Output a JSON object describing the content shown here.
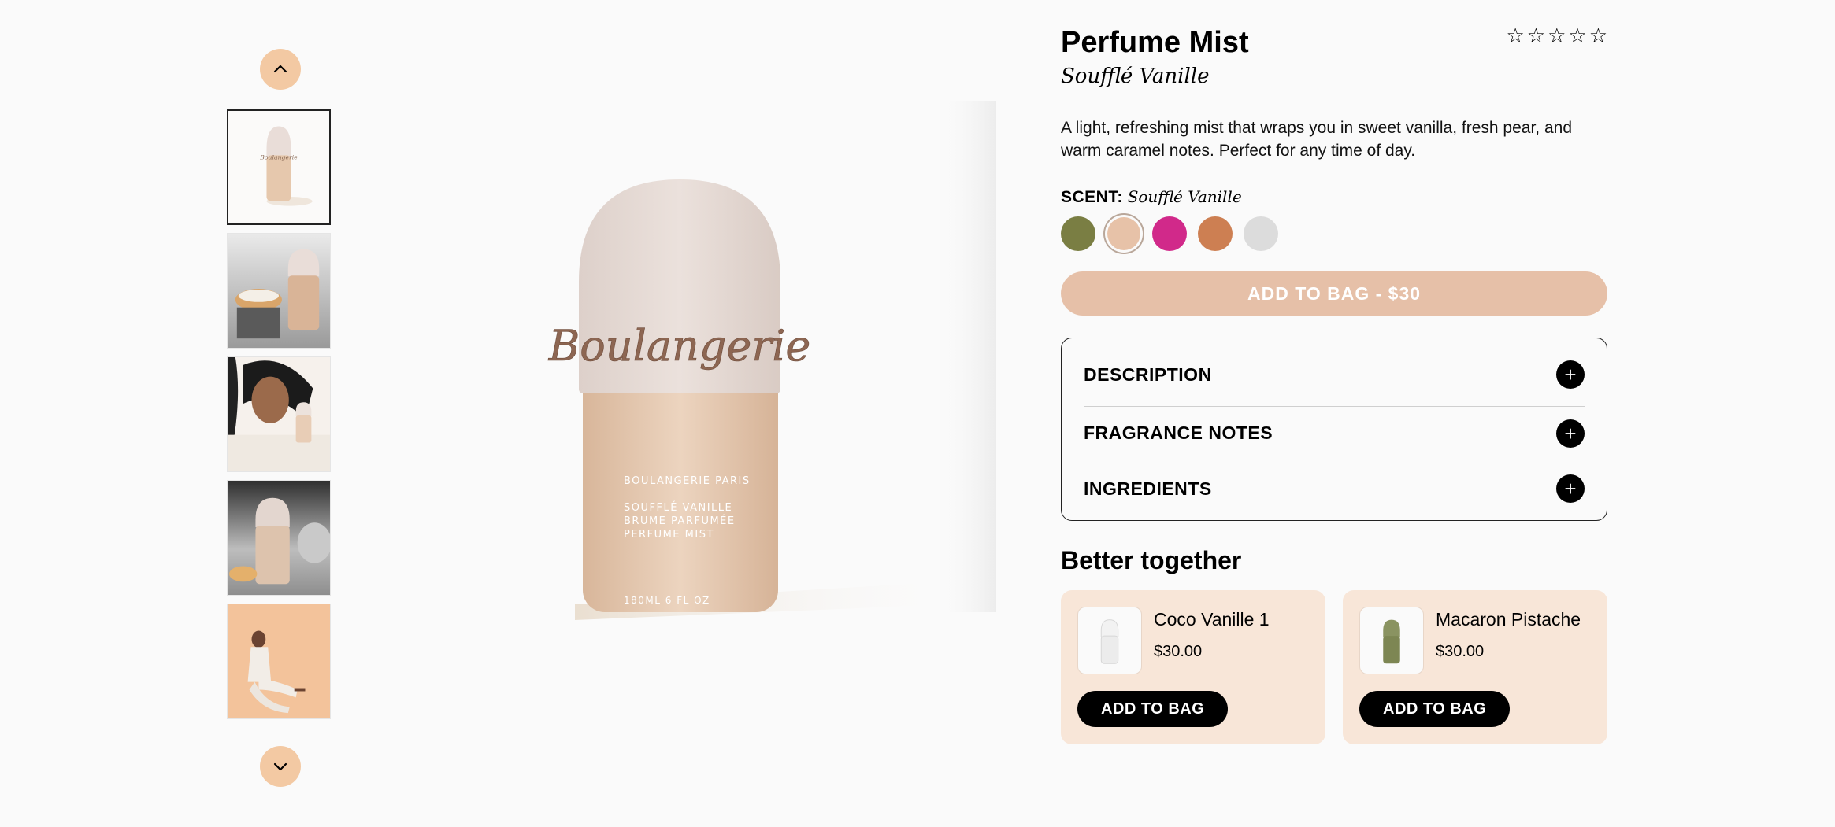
{
  "thumbnails": [
    {
      "name": "bottle-front"
    },
    {
      "name": "bottle-with-dessert"
    },
    {
      "name": "model-with-bottle"
    },
    {
      "name": "bottle-with-pastry"
    },
    {
      "name": "model-seated"
    }
  ],
  "main_image": {
    "brand": "Boulangerie",
    "label_line1": "BOULANGERIE PARIS",
    "label_line2": "SOUFFLÉ VANILLE",
    "label_line3": "BRUME PARFUMÉE",
    "label_line4": "PERFUME MIST",
    "volume": "180ML 6 FL OZ"
  },
  "product": {
    "title": "Perfume Mist",
    "subtitle": "Soufflé Vanille",
    "rating": 0,
    "stars": [
      "☆",
      "☆",
      "☆",
      "☆",
      "☆"
    ],
    "description": "A light, refreshing mist that wraps you in sweet vanilla, fresh pear, and warm caramel notes. Perfect for any time of day.",
    "scent_label": "SCENT:",
    "scent_value": "Soufflé Vanille",
    "swatches": [
      {
        "color": "#7a7e43"
      },
      {
        "color": "#e7c2a8",
        "selected": true
      },
      {
        "color": "#d1298a"
      },
      {
        "color": "#cd7f52"
      },
      {
        "color": "#dcdcdc"
      }
    ],
    "add_to_bag": "ADD TO BAG - $30"
  },
  "accordion": [
    {
      "label": "DESCRIPTION"
    },
    {
      "label": "FRAGRANCE NOTES"
    },
    {
      "label": "INGREDIENTS"
    }
  ],
  "better_together": {
    "heading": "Better together",
    "items": [
      {
        "name": "Coco Vanille 1",
        "price": "$30.00",
        "button": "ADD TO BAG",
        "bottle_color": "#ececec"
      },
      {
        "name": "Macaron Pistache",
        "price": "$30.00",
        "button": "ADD TO BAG",
        "bottle_color": "#7d8653"
      }
    ]
  },
  "icons": {
    "up": "chevron-up-icon",
    "down": "chevron-down-icon",
    "plus": "plus-icon",
    "star": "star-outline-icon"
  }
}
